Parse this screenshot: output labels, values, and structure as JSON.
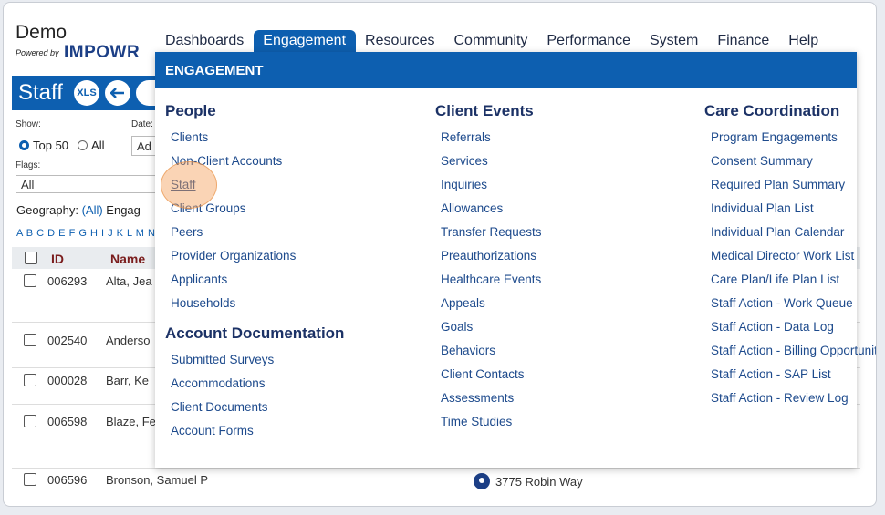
{
  "logo": {
    "demo": "Demo",
    "powered": "Powered by",
    "brand": "IMPOWR"
  },
  "nav": [
    "Dashboards",
    "Engagement",
    "Resources",
    "Community",
    "Performance",
    "System",
    "Finance",
    "Help"
  ],
  "staff_bar": {
    "title": "Staff",
    "xls": "XLS"
  },
  "filters": {
    "show_label": "Show:",
    "date_label": "Date:",
    "top50": "Top 50",
    "all": "All",
    "date_value": "Ad",
    "flags_label": "Flags:",
    "flags_value": "All",
    "geo_label": "Geography:",
    "geo_value": "(All)",
    "engag_label": "Engag",
    "alpha": "A B C D E F G H I J K L M N O"
  },
  "table": {
    "headers": {
      "id": "ID",
      "name": "Name"
    },
    "rows": [
      {
        "id": "006293",
        "name": "Alta, Jea"
      },
      {
        "id": "002540",
        "name": "Anderso"
      },
      {
        "id": "000028",
        "name": "Barr, Ke"
      },
      {
        "id": "006598",
        "name": "Blaze, Fe"
      },
      {
        "id": "006596",
        "name": "Bronson, Samuel P"
      }
    ],
    "address": "3775 Robin Way"
  },
  "menu": {
    "title": "ENGAGEMENT",
    "people": {
      "heading": "People",
      "items": [
        "Clients",
        "Non-Client Accounts",
        "Staff",
        "Client Groups",
        "Peers",
        "Provider Organizations",
        "Applicants",
        "Households"
      ]
    },
    "account_docs": {
      "heading": "Account Documentation",
      "items": [
        "Submitted Surveys",
        "Accommodations",
        "Client Documents",
        "Account Forms"
      ]
    },
    "client_events": {
      "heading": "Client Events",
      "items": [
        "Referrals",
        "Services",
        "Inquiries",
        "Allowances",
        "Transfer Requests",
        "Preauthorizations",
        "Healthcare Events",
        "Appeals",
        "Goals",
        "Behaviors",
        "Client Contacts",
        "Assessments",
        "Time Studies"
      ]
    },
    "care_coord": {
      "heading": "Care Coordination",
      "items": [
        "Program Engagements",
        "Consent Summary",
        "Required Plan Summary",
        "Individual Plan List",
        "Individual Plan Calendar",
        "Medical Director Work List",
        "Care Plan/Life Plan List",
        "Staff Action - Work Queue",
        "Staff Action - Data Log",
        "Staff Action - Billing Opportunities",
        "Staff Action - SAP List",
        "Staff Action - Review Log"
      ]
    }
  }
}
